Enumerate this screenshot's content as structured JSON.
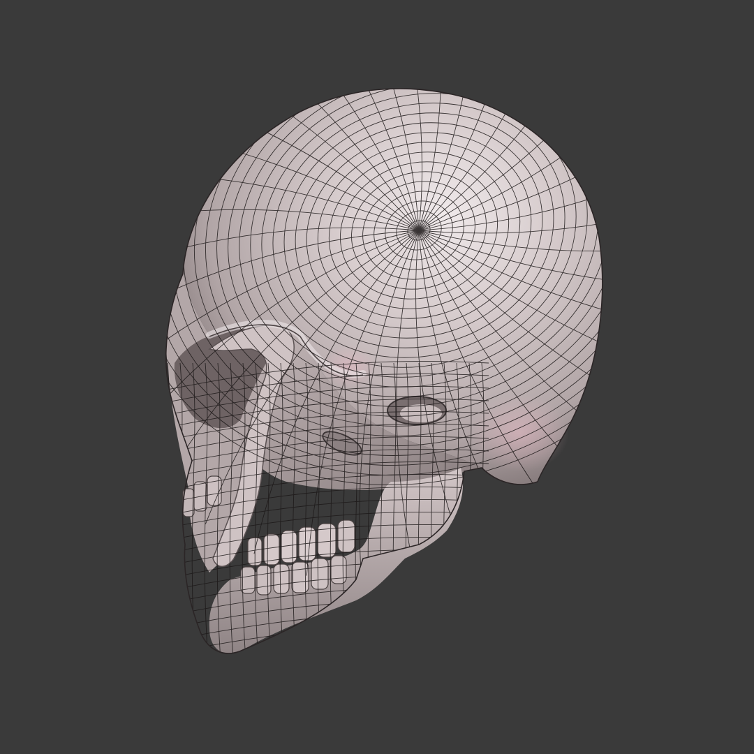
{
  "viewport": {
    "background_color": "#3a3a3a",
    "subject": "skull-wireframe-model",
    "shading": "smooth-clay-with-quad-wireframe",
    "mesh_color": "#cbbfc0",
    "mesh_highlight": "#ece5e6",
    "mesh_shadow": "#7f7474",
    "wire_color": "#1c1818"
  }
}
